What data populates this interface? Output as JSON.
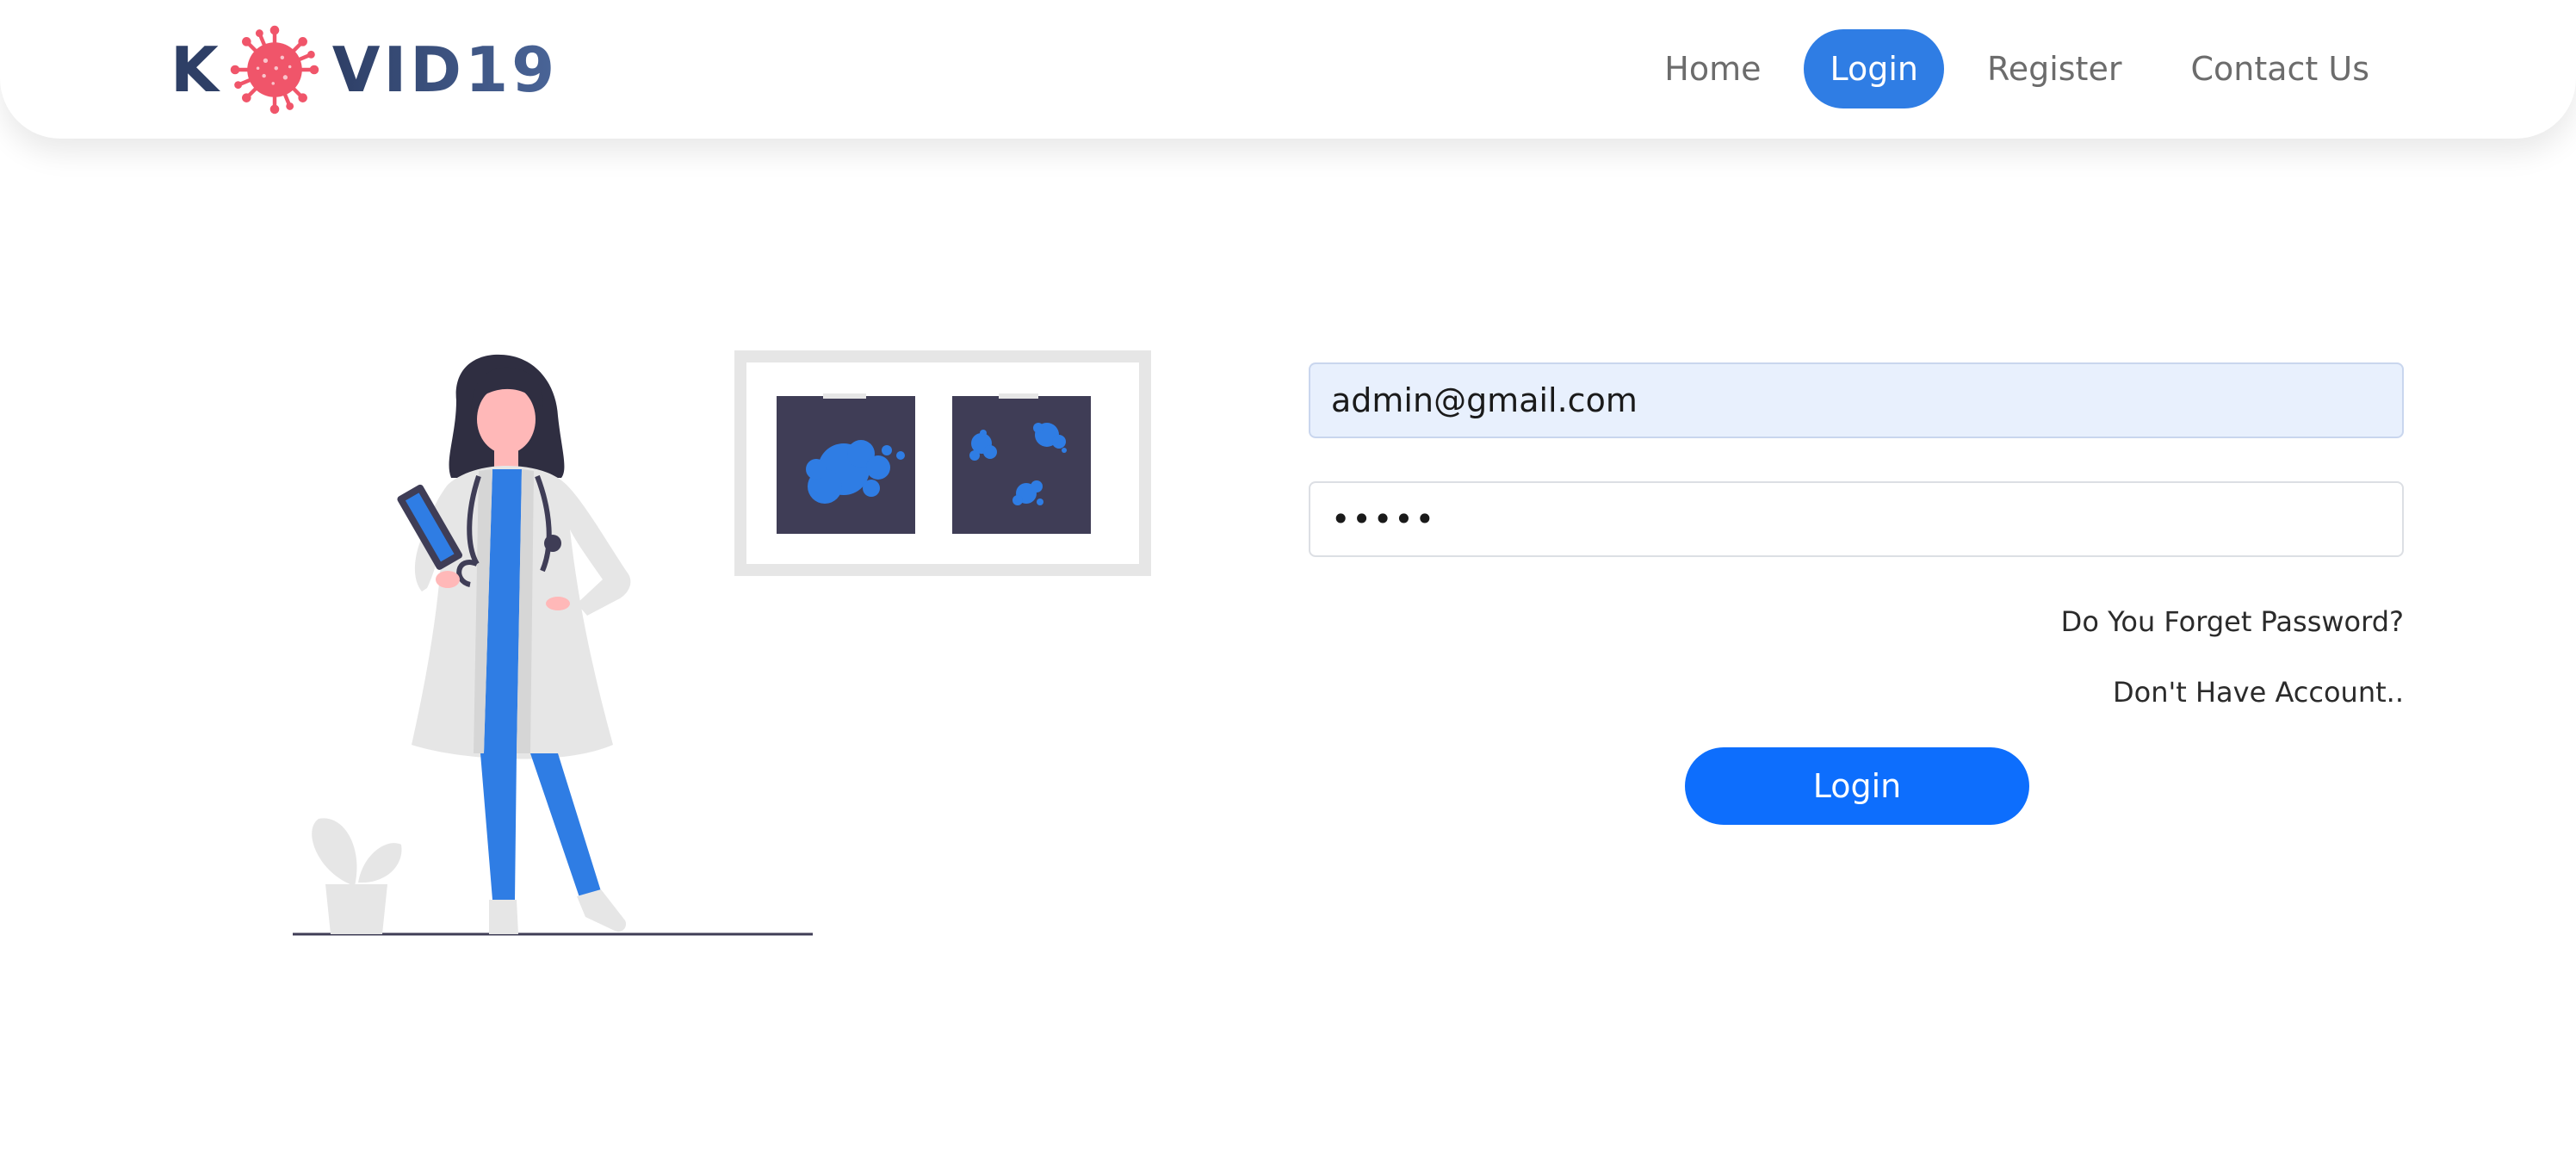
{
  "brand": {
    "logo_k": "K",
    "logo_rest": "VID19",
    "logo_icon": "virus-icon"
  },
  "nav": {
    "items": [
      {
        "label": "Home",
        "active": false
      },
      {
        "label": "Login",
        "active": true
      },
      {
        "label": "Register",
        "active": false
      },
      {
        "label": "Contact Us",
        "active": false
      }
    ]
  },
  "illustration": {
    "icon": "doctor-with-xray-illustration"
  },
  "login_form": {
    "email_value": "admin@gmail.com",
    "password_value": "•••••",
    "forgot_password_label": "Do You Forget Password?",
    "no_account_label": "Don't Have Account..",
    "submit_label": "Login"
  },
  "colors": {
    "accent": "#0d6efd",
    "nav_active": "#2f7de4",
    "virus_red": "#f0556a",
    "brand_navy": "#34466b",
    "input_autofill_bg": "#e8f0fd",
    "xray_dark": "#3f3d56"
  }
}
